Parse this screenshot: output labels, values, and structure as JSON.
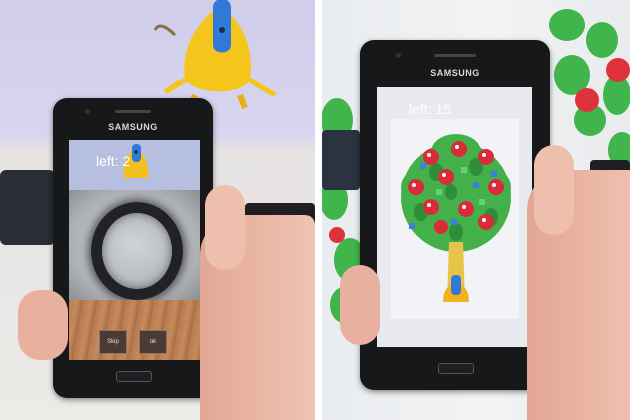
{
  "left_phone": {
    "brand": "SAMSUNG",
    "hud_text": "left: 2",
    "buttons": [
      "Skip",
      "ok"
    ]
  },
  "right_phone": {
    "brand": "SAMSUNG",
    "hud_text": "left: 15"
  },
  "colors": {
    "hud_text": "#ffffff",
    "phone_body": "#17181a",
    "skin": "#e9b7a6"
  },
  "icons": [
    "monster-character",
    "tree-with-monsters"
  ]
}
